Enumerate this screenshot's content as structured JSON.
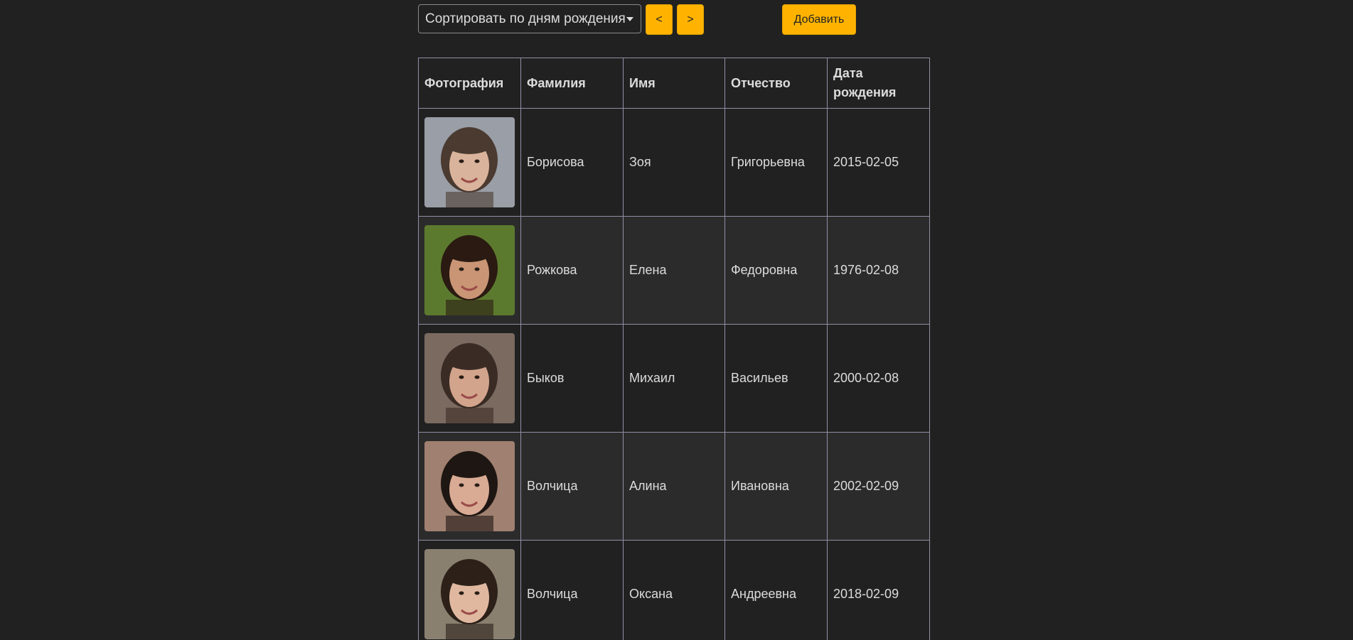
{
  "toolbar": {
    "sort_label": "Сортировать по дням рождения",
    "prev_label": "<",
    "next_label": ">",
    "add_label": "Добавить",
    "accent_color": "#ffb300"
  },
  "table": {
    "headers": [
      "Фотография",
      "Фамилия",
      "Имя",
      "Отчество",
      "Дата рождения"
    ],
    "rows": [
      {
        "last_name": "Борисова",
        "first_name": "Зоя",
        "patronymic": "Григорьевна",
        "birth_date": "2015-02-05",
        "photo": {
          "bg": "#9a9ea6",
          "skin": "#d9b39b",
          "hair": "#4a3a30"
        }
      },
      {
        "last_name": "Рожкова",
        "first_name": "Елена",
        "patronymic": "Федоровна",
        "birth_date": "1976-02-08",
        "photo": {
          "bg": "#5c7a2e",
          "skin": "#c99575",
          "hair": "#2a1a12"
        }
      },
      {
        "last_name": "Быков",
        "first_name": "Михаил",
        "patronymic": "Васильев",
        "birth_date": "2000-02-08",
        "photo": {
          "bg": "#7a6a60",
          "skin": "#d2a48c",
          "hair": "#3a2c24"
        }
      },
      {
        "last_name": "Волчица",
        "first_name": "Алина",
        "patronymic": "Ивановна",
        "birth_date": "2002-02-09",
        "photo": {
          "bg": "#a08070",
          "skin": "#d9aa94",
          "hair": "#1e1612"
        }
      },
      {
        "last_name": "Волчица",
        "first_name": "Оксана",
        "patronymic": "Андреевна",
        "birth_date": "2018-02-09",
        "photo": {
          "bg": "#8a8070",
          "skin": "#e0b8a0",
          "hair": "#2c2018"
        }
      }
    ]
  }
}
